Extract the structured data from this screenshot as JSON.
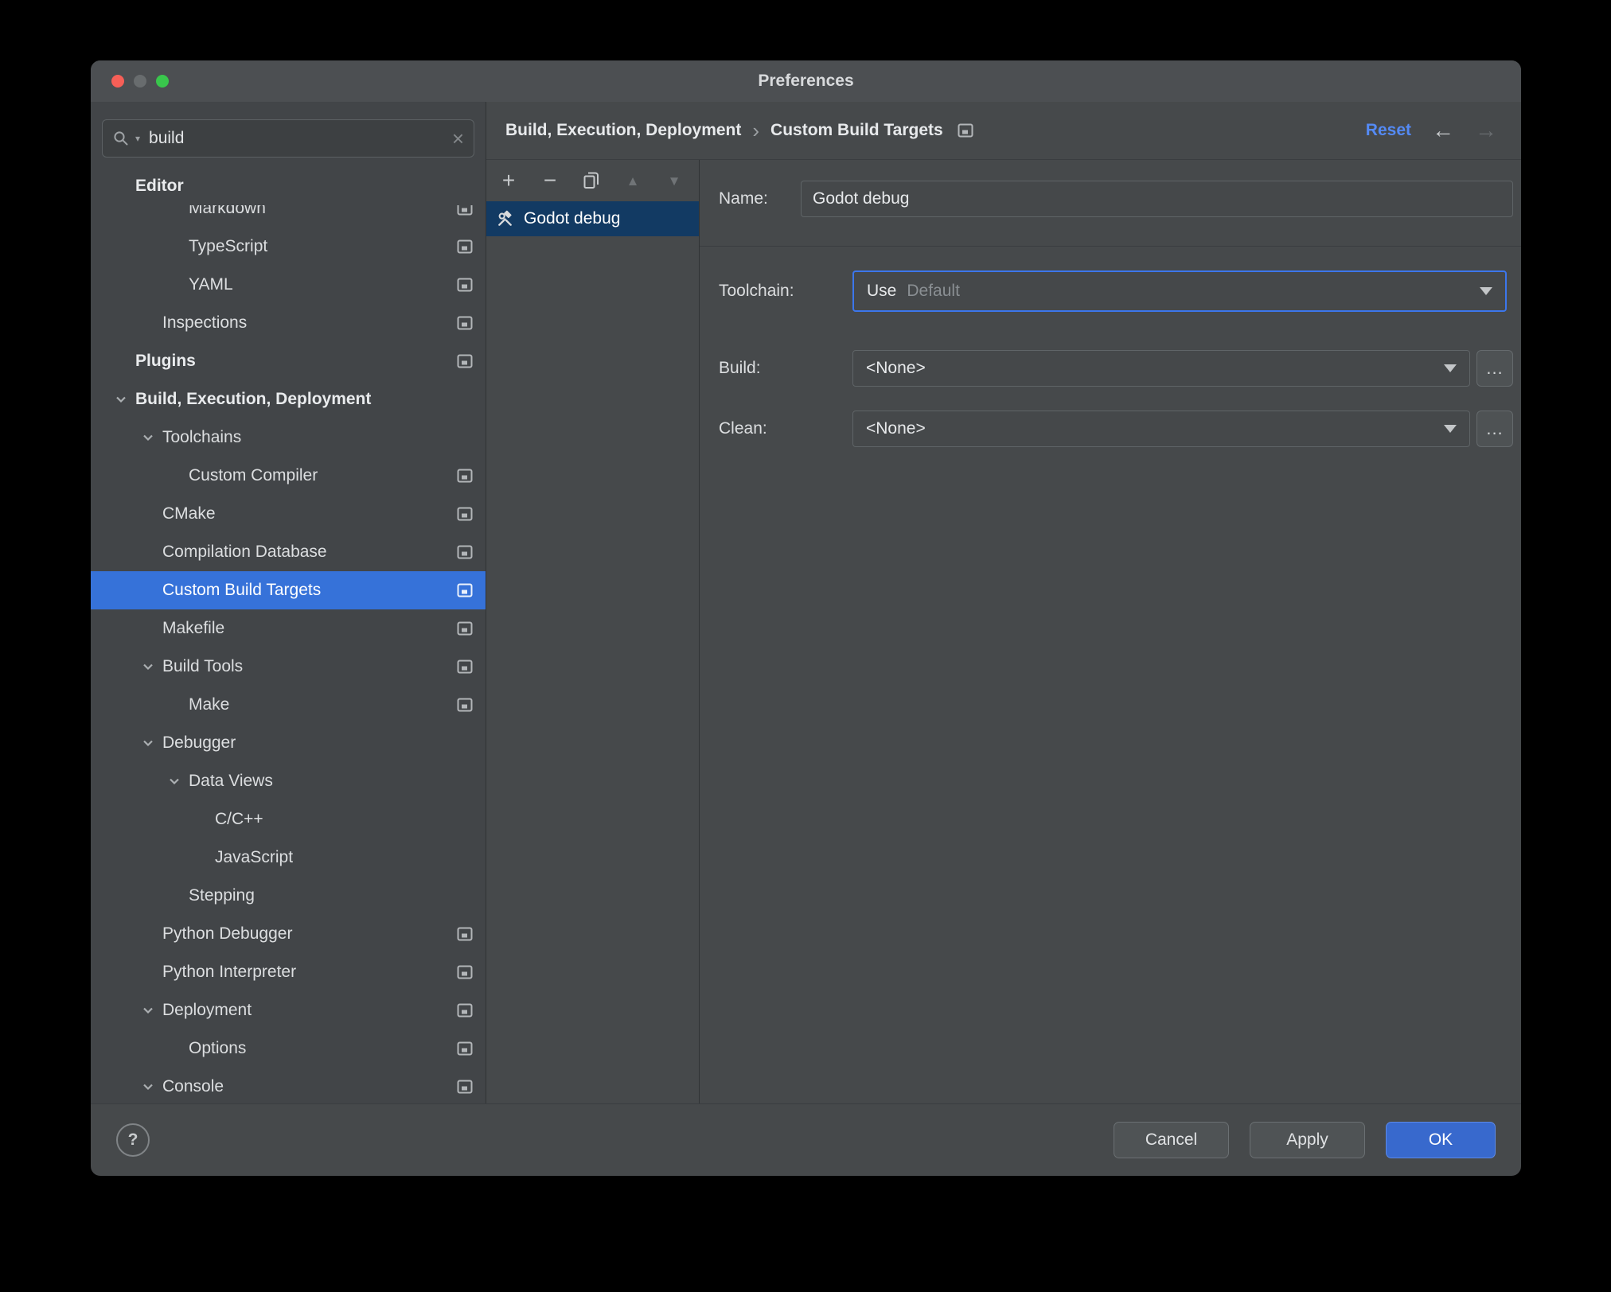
{
  "window": {
    "title": "Preferences"
  },
  "search": {
    "value": "build"
  },
  "sidebar": {
    "sticky_header": "Editor",
    "items": [
      {
        "label": "Markdown",
        "indent": 2,
        "gear": true
      },
      {
        "label": "TypeScript",
        "indent": 2,
        "gear": true
      },
      {
        "label": "YAML",
        "indent": 2,
        "gear": true
      },
      {
        "label": "Inspections",
        "indent": 1,
        "gear": true
      },
      {
        "label": "Plugins",
        "indent": 0,
        "bold": true,
        "gear": true
      },
      {
        "label": "Build, Execution, Deployment",
        "indent": 0,
        "bold": true,
        "chevron": true
      },
      {
        "label": "Toolchains",
        "indent": 1,
        "chevron": true
      },
      {
        "label": "Custom Compiler",
        "indent": 2,
        "gear": true
      },
      {
        "label": "CMake",
        "indent": 1,
        "gear": true
      },
      {
        "label": "Compilation Database",
        "indent": 1,
        "gear": true
      },
      {
        "label": "Custom Build Targets",
        "indent": 1,
        "gear": true,
        "selected": true
      },
      {
        "label": "Makefile",
        "indent": 1,
        "gear": true
      },
      {
        "label": "Build Tools",
        "indent": 1,
        "chevron": true,
        "gear": true
      },
      {
        "label": "Make",
        "indent": 2,
        "gear": true
      },
      {
        "label": "Debugger",
        "indent": 1,
        "chevron": true
      },
      {
        "label": "Data Views",
        "indent": 2,
        "chevron": true
      },
      {
        "label": "C/C++",
        "indent": 3
      },
      {
        "label": "JavaScript",
        "indent": 3
      },
      {
        "label": "Stepping",
        "indent": 2
      },
      {
        "label": "Python Debugger",
        "indent": 1,
        "gear": true
      },
      {
        "label": "Python Interpreter",
        "indent": 1,
        "gear": true
      },
      {
        "label": "Deployment",
        "indent": 1,
        "chevron": true,
        "gear": true
      },
      {
        "label": "Options",
        "indent": 2,
        "gear": true
      },
      {
        "label": "Console",
        "indent": 1,
        "chevron": true,
        "gear": true
      }
    ]
  },
  "breadcrumb": {
    "parts": [
      "Build, Execution, Deployment",
      "Custom Build Targets"
    ],
    "reset_label": "Reset",
    "back_icon": "←",
    "forward_icon": "→",
    "separator_icon": "›"
  },
  "toolbar_icons": {
    "add": "+",
    "remove": "−",
    "move_up": "▲",
    "move_down": "▼"
  },
  "targets": {
    "items": [
      {
        "label": "Godot debug",
        "selected": true
      }
    ]
  },
  "form": {
    "name_label": "Name:",
    "name_value": "Godot debug",
    "toolchain_label": "Toolchain:",
    "toolchain_value": "Use",
    "toolchain_placeholder": "Default",
    "build_label": "Build:",
    "build_value": "<None>",
    "clean_label": "Clean:",
    "clean_value": "<None>",
    "browse_label": "..."
  },
  "footer": {
    "help": "?",
    "cancel": "Cancel",
    "apply": "Apply",
    "ok": "OK"
  },
  "colors": {
    "accent_selection": "#3672d9",
    "list_selection": "#123a63",
    "focus_border": "#3c76ec",
    "reset_link": "#548af5",
    "primary_button": "#3869cd"
  }
}
